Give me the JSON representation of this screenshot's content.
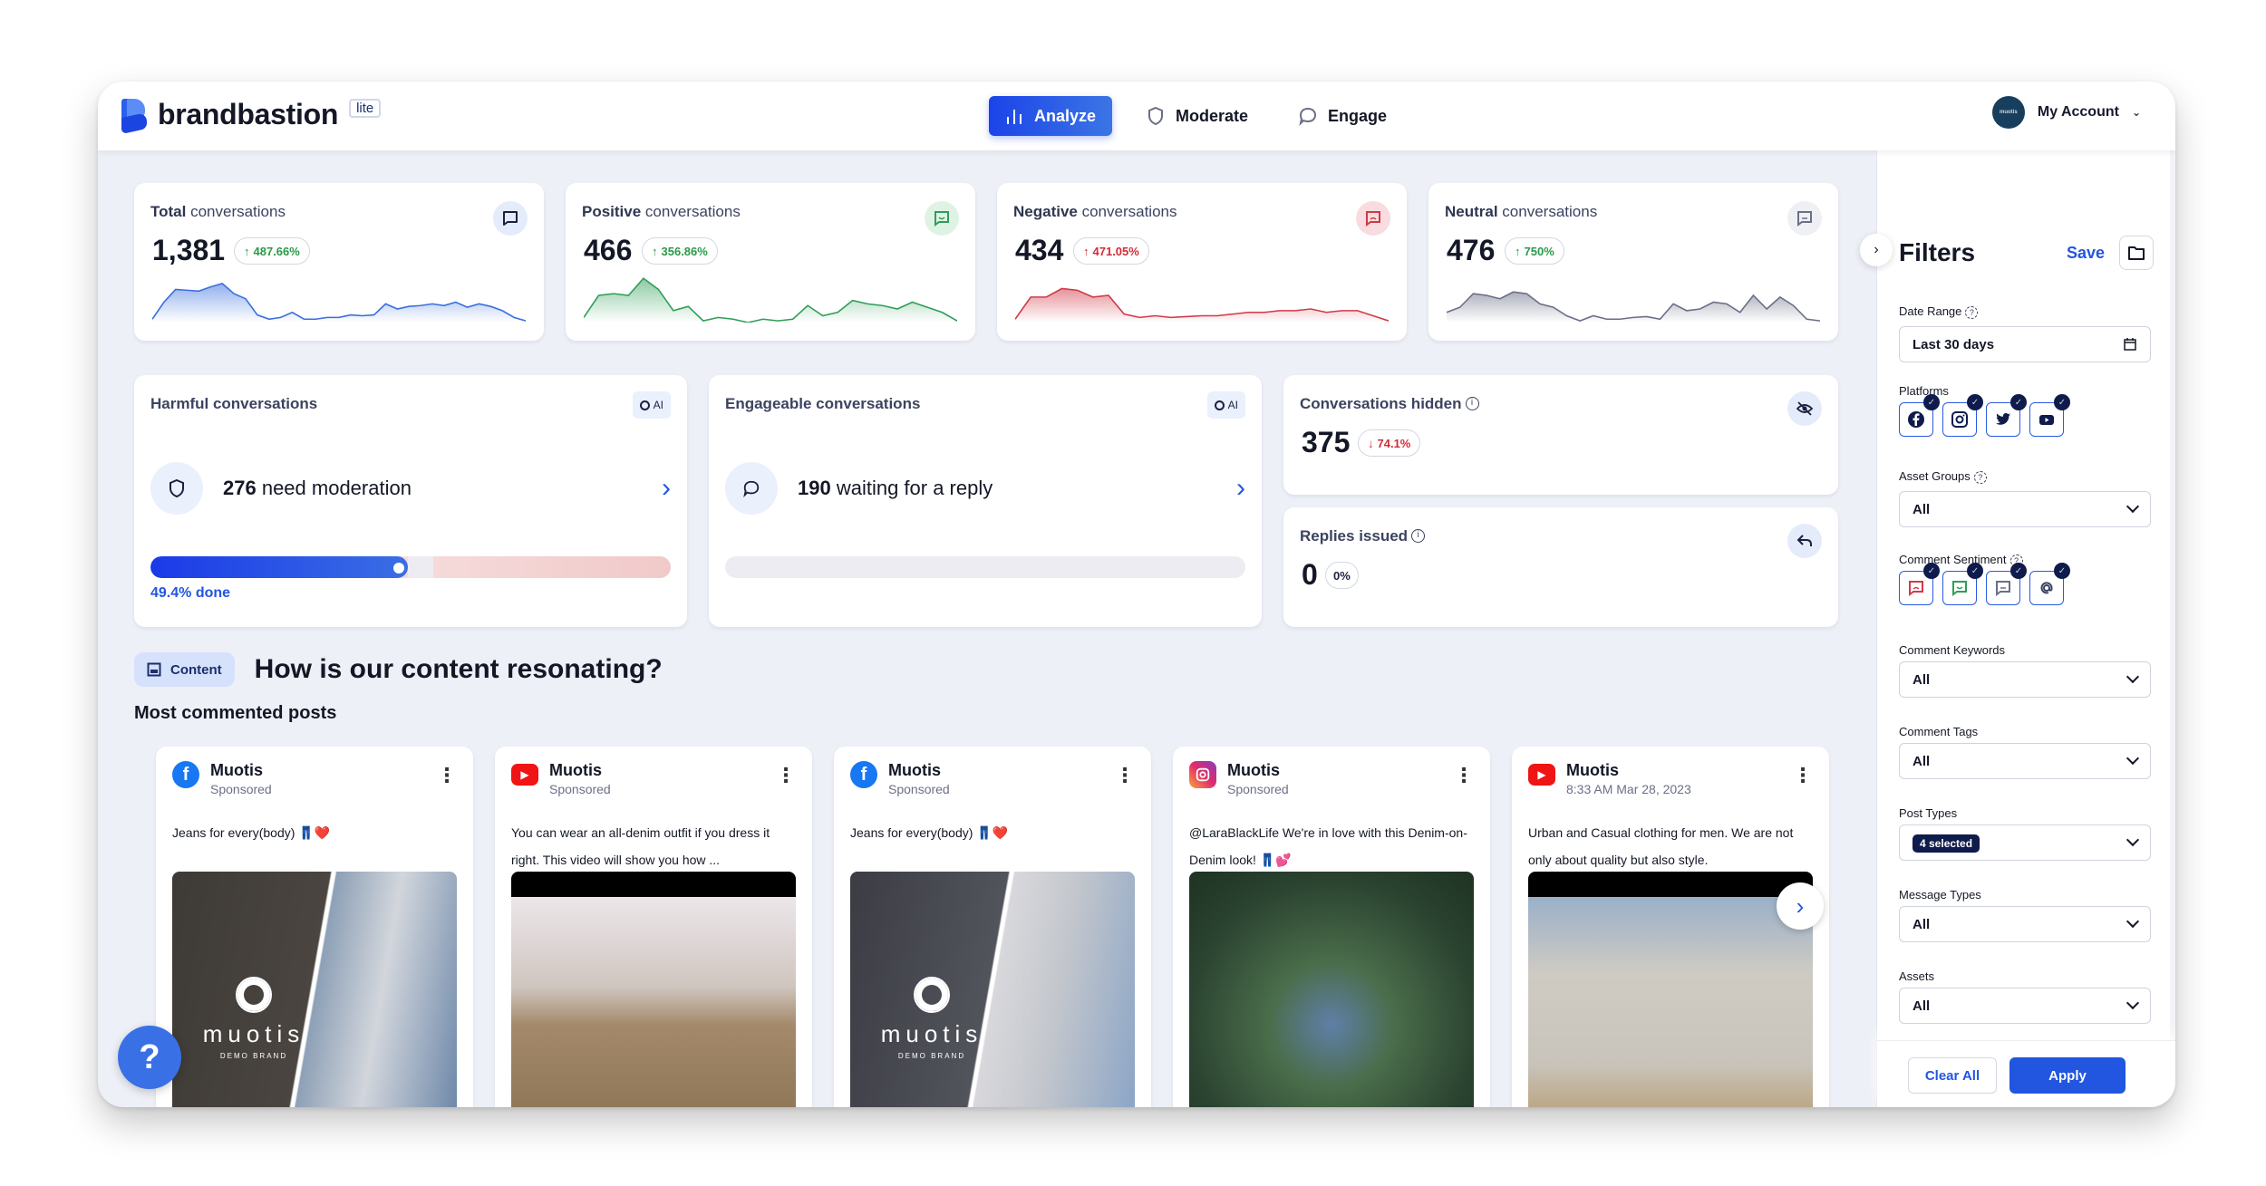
{
  "app": {
    "brand": "brandbastion",
    "edition_badge": "lite"
  },
  "nav": {
    "items": [
      {
        "label": "Analyze",
        "icon": "bar-chart-icon",
        "active": true
      },
      {
        "label": "Moderate",
        "icon": "shield-icon",
        "active": false
      },
      {
        "label": "Engage",
        "icon": "chat-bubble-icon",
        "active": false
      }
    ]
  },
  "account": {
    "label": "My Account",
    "avatar_text": "muotis"
  },
  "kpis": [
    {
      "title_bold": "Total",
      "title_rest": " conversations",
      "value": "1,381",
      "change": "487.66%",
      "direction": "up",
      "icon": "chat-bubble-icon",
      "color": "#3a6fdc",
      "sparkline": [
        60,
        40,
        25,
        26,
        27,
        22,
        18,
        30,
        36,
        55,
        60,
        58,
        52,
        60,
        60,
        58,
        58,
        55,
        56,
        55,
        42,
        48,
        45,
        44,
        42,
        44,
        40,
        46,
        42,
        45,
        50,
        58,
        62
      ]
    },
    {
      "title_bold": "Positive",
      "title_rest": " conversations",
      "value": "466",
      "change": "356.86%",
      "direction": "up",
      "icon": "happy-chat-icon",
      "color": "#2f9e57",
      "sparkline": [
        58,
        32,
        30,
        32,
        12,
        25,
        50,
        45,
        62,
        58,
        60,
        64,
        60,
        62,
        60,
        44,
        56,
        52,
        38,
        42,
        44,
        48,
        40,
        46,
        52,
        62
      ]
    },
    {
      "title_bold": "Negative",
      "title_rest": " conversations",
      "value": "434",
      "change": "471.05%",
      "direction": "up",
      "icon": "sad-chat-icon",
      "color": "#d03a48",
      "sparkline": [
        60,
        34,
        34,
        24,
        26,
        34,
        32,
        54,
        58,
        56,
        58,
        57,
        56,
        56,
        54,
        52,
        52,
        50,
        50,
        48,
        52,
        50,
        50,
        56,
        62
      ]
    },
    {
      "title_bold": "Neutral",
      "title_rest": " conversations",
      "value": "476",
      "change": "750%",
      "direction": "up",
      "icon": "neutral-chat-icon",
      "color": "#6a6f86",
      "sparkline": [
        52,
        46,
        30,
        32,
        36,
        28,
        30,
        42,
        46,
        56,
        62,
        56,
        60,
        60,
        58,
        57,
        60,
        42,
        50,
        48,
        40,
        42,
        52,
        32,
        48,
        34,
        44,
        60,
        62
      ]
    }
  ],
  "harmful": {
    "title": "Harmful conversations",
    "ai_badge": "AI",
    "count": "276",
    "text": " need moderation",
    "progress_pct": 49.4,
    "progress_label": "49.4% done"
  },
  "engageable": {
    "title": "Engageable conversations",
    "ai_badge": "AI",
    "count": "190",
    "text": " waiting for a reply",
    "progress_pct": 0
  },
  "hidden": {
    "title": "Conversations hidden",
    "value": "375",
    "change": "74.1%",
    "direction": "down"
  },
  "replies": {
    "title": "Replies issued",
    "value": "0",
    "change": "0%",
    "direction": "neutral"
  },
  "content": {
    "tag": "Content",
    "title": "How is our content resonating?",
    "subtitle": "Most commented posts",
    "posts": [
      {
        "platform": "facebook",
        "brand": "Muotis",
        "sub": "Sponsored",
        "text": "Jeans for every(body) 👖❤️",
        "image": "img1",
        "has_brand_overlay": true
      },
      {
        "platform": "youtube",
        "brand": "Muotis",
        "sub": "Sponsored",
        "text": "You can wear an all-denim outfit if you dress it right. This video will show you how ...",
        "image": "img2",
        "has_brand_overlay": false
      },
      {
        "platform": "facebook",
        "brand": "Muotis",
        "sub": "Sponsored",
        "text": "Jeans for every(body) 👖❤️",
        "image": "img3",
        "has_brand_overlay": true
      },
      {
        "platform": "instagram",
        "brand": "Muotis",
        "sub": "Sponsored",
        "text": "@LaraBlackLife We're in love with this Denim-on-Denim look! 👖💕",
        "image": "img4",
        "has_brand_overlay": false
      },
      {
        "platform": "youtube",
        "brand": "Muotis",
        "sub": "8:33 AM Mar 28, 2023",
        "text": "Urban and Casual clothing for men. We are not only about quality but also style.",
        "image": "img5",
        "has_brand_overlay": false
      }
    ],
    "overlay_word": "muotis",
    "overlay_sub": "DEMO BRAND"
  },
  "help": {
    "label": "?"
  },
  "filters": {
    "title": "Filters",
    "save_label": "Save",
    "date_range": {
      "label": "Date Range",
      "value": "Last 30 days"
    },
    "platforms": {
      "label": "Platforms",
      "items": [
        "facebook",
        "instagram",
        "twitter",
        "youtube"
      ]
    },
    "asset_groups": {
      "label": "Asset Groups",
      "value": "All"
    },
    "comment_sentiment": {
      "label": "Comment Sentiment",
      "items": [
        "negative",
        "positive",
        "neutral",
        "mention"
      ]
    },
    "comment_keywords": {
      "label": "Comment Keywords",
      "value": "All"
    },
    "comment_tags": {
      "label": "Comment Tags",
      "value": "All"
    },
    "post_types": {
      "label": "Post Types",
      "value": "4 selected"
    },
    "message_types": {
      "label": "Message Types",
      "value": "All"
    },
    "assets": {
      "label": "Assets",
      "value": "All"
    },
    "clear_label": "Clear All",
    "apply_label": "Apply"
  }
}
